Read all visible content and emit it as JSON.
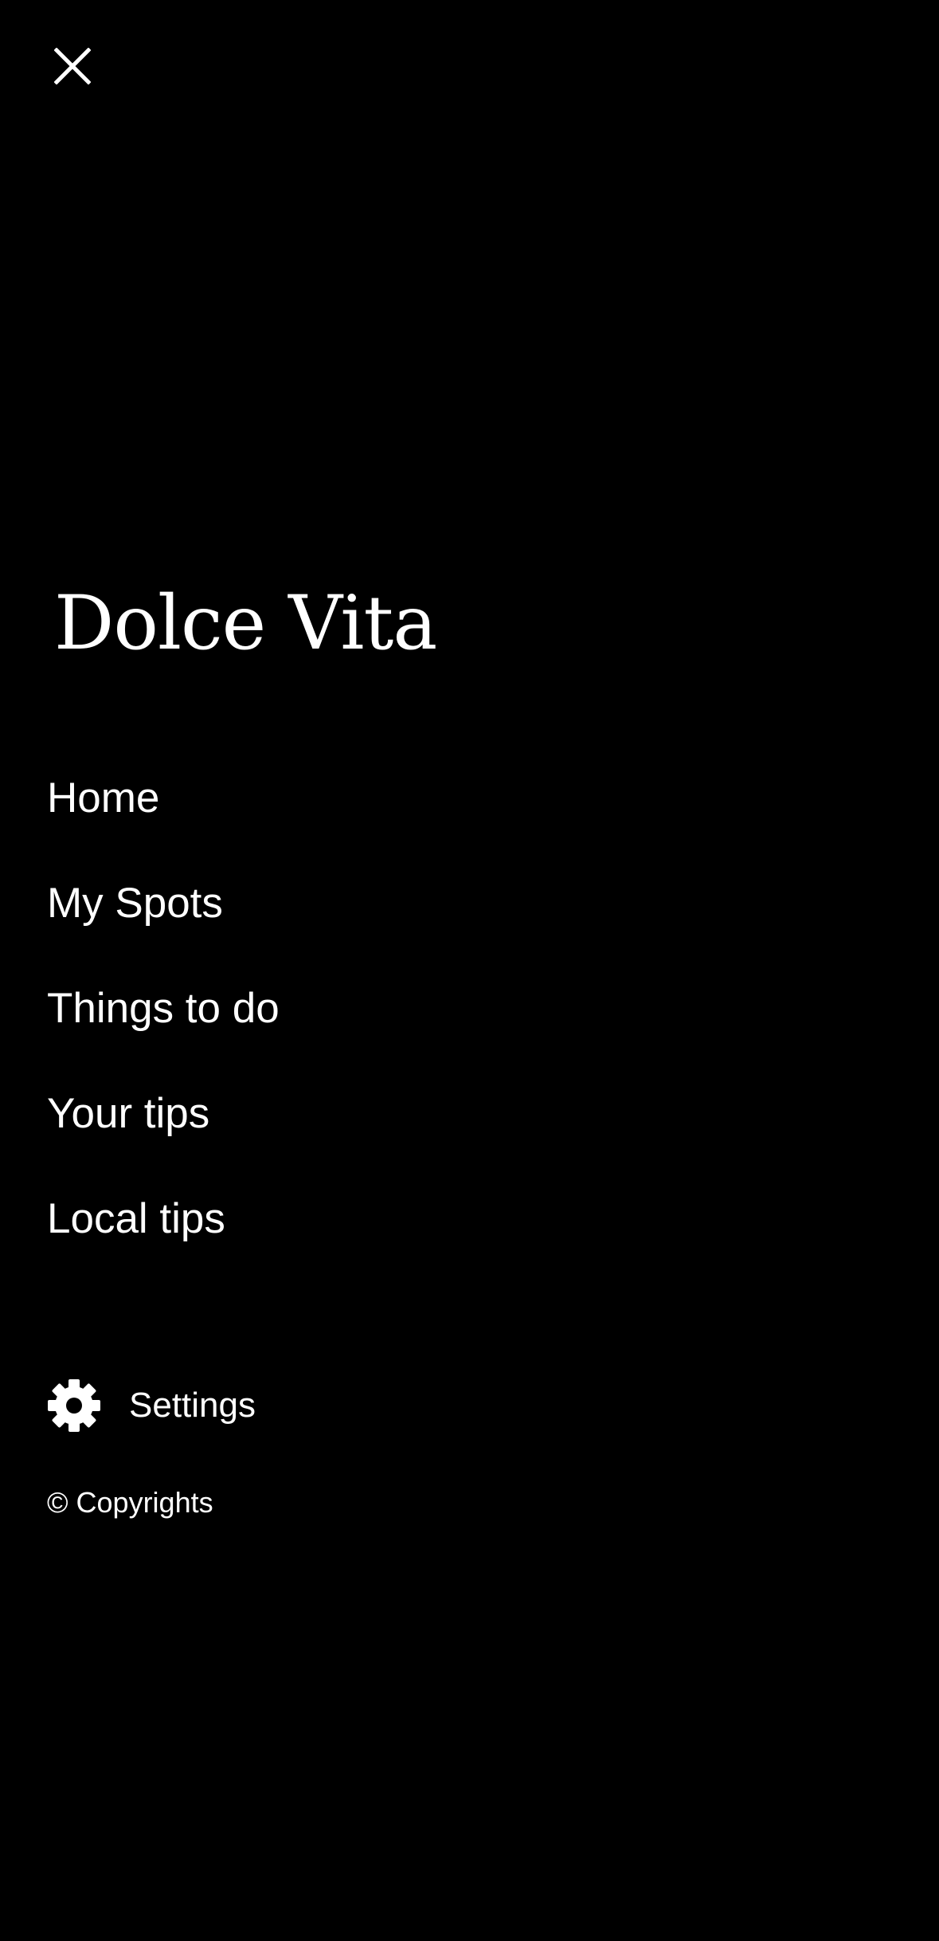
{
  "menu": {
    "close_icon": "close-icon",
    "brand_title": "Dolce Vita",
    "nav_items": [
      {
        "label": "Home"
      },
      {
        "label": "My Spots"
      },
      {
        "label": "Things to do"
      },
      {
        "label": "Your tips"
      },
      {
        "label": "Local tips"
      }
    ],
    "settings": {
      "icon": "gear-icon",
      "label": "Settings"
    },
    "copyright": "© Copyrights"
  },
  "colors": {
    "background": "#000000",
    "text": "#ffffff"
  }
}
